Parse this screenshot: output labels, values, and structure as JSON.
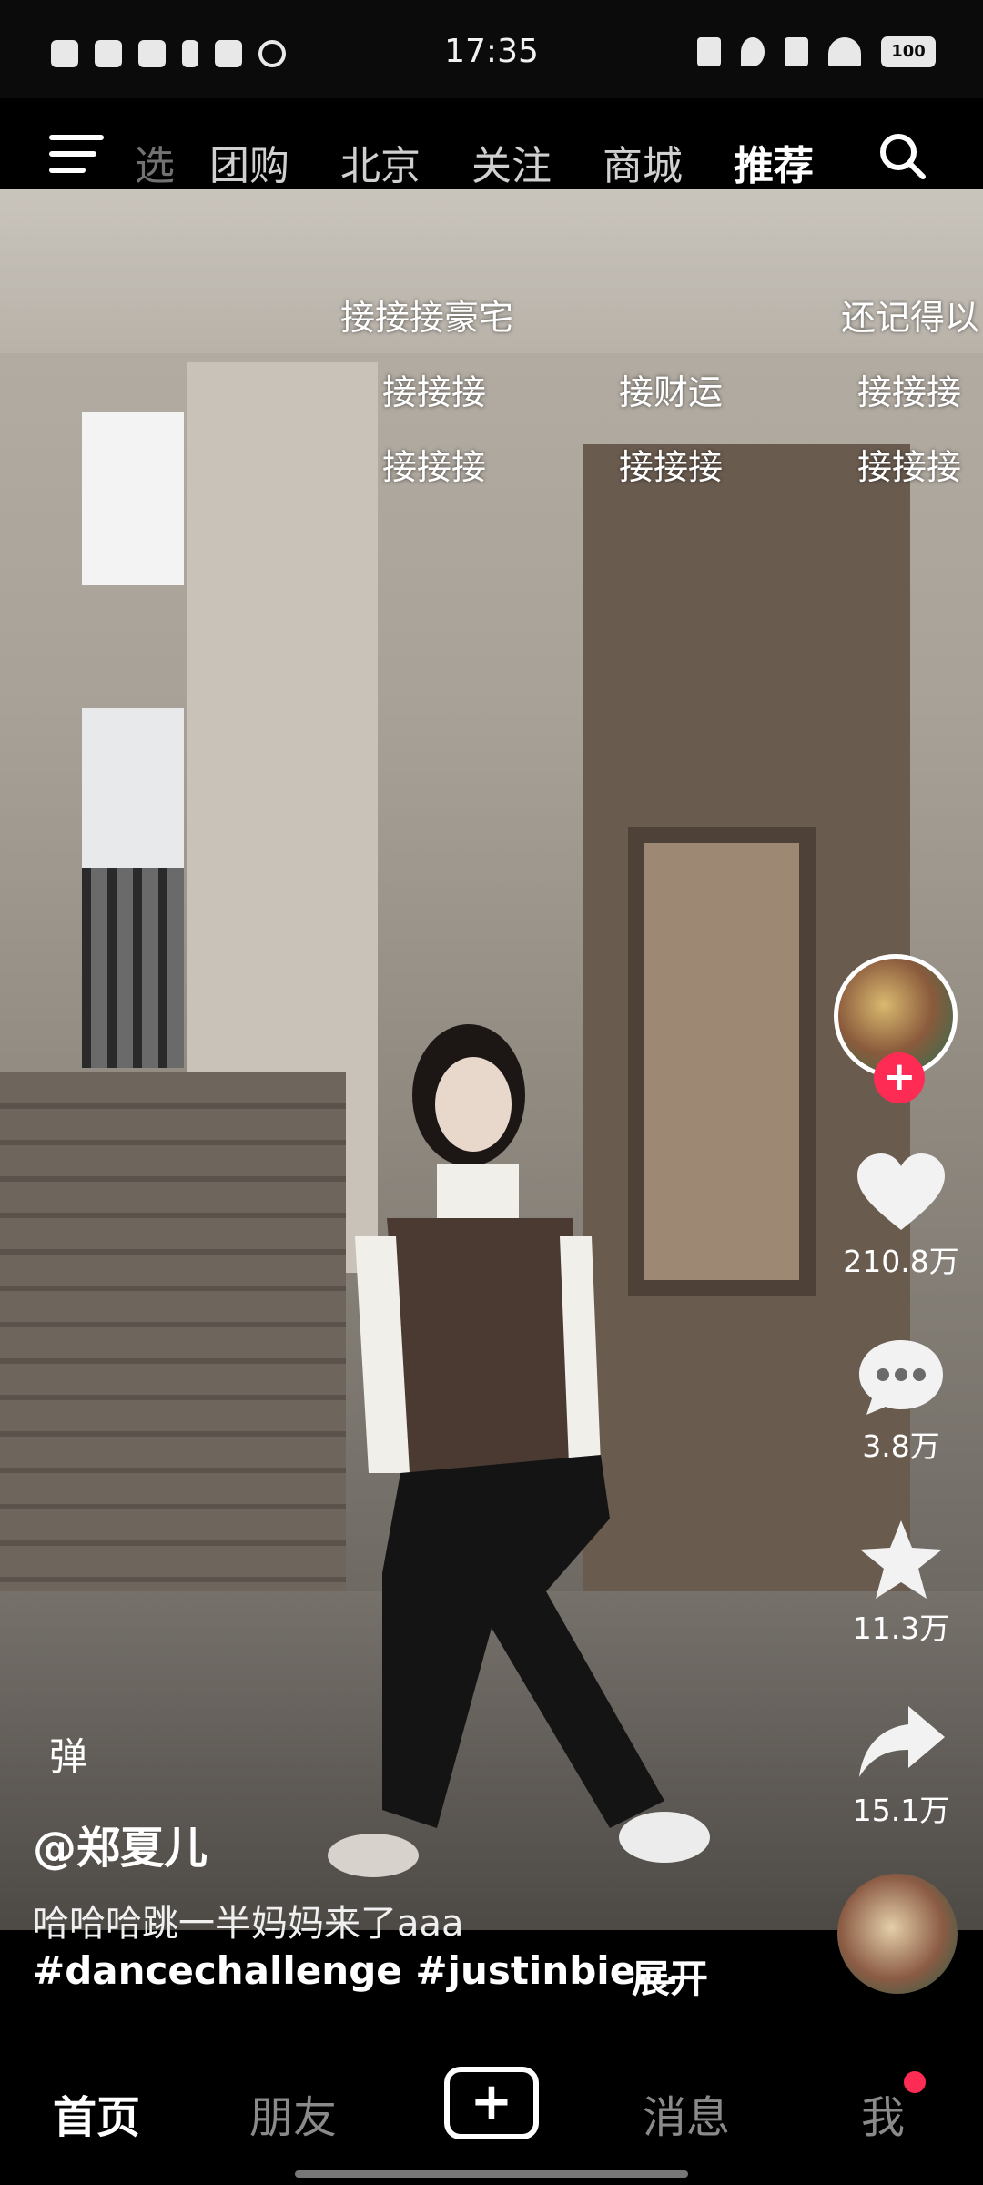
{
  "status_bar": {
    "time": "17:35",
    "battery": "100"
  },
  "top_nav": {
    "partial_tab": "选",
    "tabs": [
      {
        "label": "团购",
        "active": false
      },
      {
        "label": "北京",
        "active": false
      },
      {
        "label": "关注",
        "active": false
      },
      {
        "label": "商城",
        "active": false
      },
      {
        "label": "推荐",
        "active": true
      }
    ],
    "switch_glyph": "⇄"
  },
  "danmaku": [
    {
      "text": "接接接豪宅"
    },
    {
      "text": "还记得以"
    },
    {
      "text": "接接接"
    },
    {
      "text": "接财运"
    },
    {
      "text": "接接接"
    },
    {
      "text": "接接接"
    },
    {
      "text": "接接接"
    },
    {
      "text": "接接接"
    }
  ],
  "rail": {
    "likes": "210.8万",
    "comments": "3.8万",
    "favorites": "11.3万",
    "shares": "15.1万",
    "follow_plus": "+"
  },
  "caption": {
    "danmu_toggle": "弹",
    "author": "@郑夏儿",
    "description": "哈哈哈跳一半妈妈来了aaa",
    "tags": "#dancechallenge #justinbie...",
    "expand": "展开"
  },
  "bottom_nav": {
    "home": "首页",
    "friends": "朋友",
    "plus": "+",
    "messages": "消息",
    "me": "我"
  },
  "colors": {
    "accent": "#fe2c55"
  }
}
